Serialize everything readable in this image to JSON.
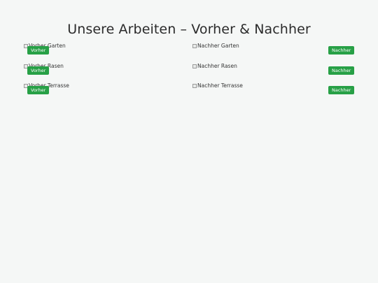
{
  "page": {
    "title": "Unsere Arbeiten – Vorher & Nachher",
    "background": "#f5f7f6",
    "accent": "#27a046"
  },
  "pairs": [
    {
      "before": {
        "alt": "Vorher Garten",
        "badge": "Vorher"
      },
      "after": {
        "alt": "Nachher Garten",
        "badge": "Nachher"
      }
    },
    {
      "before": {
        "alt": "Vorher Rasen",
        "badge": "Vorher"
      },
      "after": {
        "alt": "Nachher Rasen",
        "badge": "Nachher"
      }
    },
    {
      "before": {
        "alt": "Vorher Terrasse",
        "badge": "Vorher"
      },
      "after": {
        "alt": "Nachher Terrasse",
        "badge": "Nachher"
      }
    }
  ]
}
